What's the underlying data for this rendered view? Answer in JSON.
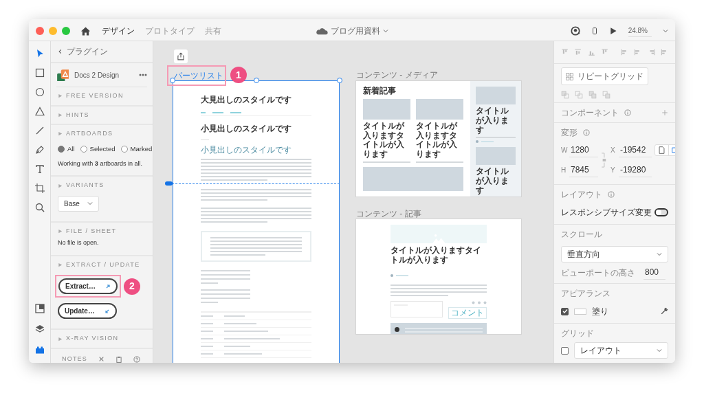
{
  "title_bar": {
    "tabs": [
      {
        "label": "デザイン",
        "selected": true
      },
      {
        "label": "プロトタイプ",
        "selected": false
      },
      {
        "label": "共有",
        "selected": false
      }
    ],
    "document_title": "ブログ用資料",
    "zoom": "24.8%"
  },
  "tools": [
    {
      "kind": "select",
      "selected": true
    },
    {
      "kind": "rectangle",
      "selected": false
    },
    {
      "kind": "ellipse",
      "selected": false
    },
    {
      "kind": "triangle",
      "selected": false
    },
    {
      "kind": "line",
      "selected": false
    },
    {
      "kind": "pen",
      "selected": false
    },
    {
      "kind": "text",
      "selected": false
    },
    {
      "kind": "artboard",
      "selected": false
    },
    {
      "kind": "zoom",
      "selected": false
    }
  ],
  "bottom_tools": [
    {
      "kind": "assets",
      "selected": false
    },
    {
      "kind": "layers",
      "selected": false
    },
    {
      "kind": "plugins",
      "selected": true
    }
  ],
  "plugin_panel": {
    "back_label": "プラグイン",
    "plugin_name": "Docs 2 Design",
    "sections": [
      {
        "kind": "header",
        "title": "FREE VERSION"
      },
      {
        "kind": "header",
        "title": "HINTS"
      },
      {
        "kind": "radios",
        "title": "ARTBOARDS",
        "options": [
          {
            "label": "All",
            "selected": true
          },
          {
            "label": "Selected",
            "selected": false
          },
          {
            "label": "Marked",
            "selected": false
          }
        ],
        "note": "Working with **3** artboards in all."
      },
      {
        "kind": "select",
        "title": "VARIANTS",
        "value": "Base"
      },
      {
        "kind": "note",
        "title": "FILE / SHEET",
        "note": "No file is open."
      },
      {
        "kind": "buttons",
        "title": "EXTRACT / UPDATE",
        "buttons": [
          {
            "label": "Extract…",
            "callout": "2"
          },
          {
            "label": "Update…"
          }
        ]
      },
      {
        "kind": "header",
        "title": "X-RAY VISION"
      }
    ],
    "notes_label": "NOTES"
  },
  "canvas": {
    "artboards": [
      {
        "kind": "parts",
        "title": "パーツリスト",
        "selected": true,
        "callout": "1",
        "heading": "大見出しのスタイルです",
        "subheading": "小見出しのスタイルです",
        "minor_heading": "小見出しのスタイルです"
      },
      {
        "kind": "media",
        "title": "コンテンツ - メディア",
        "selected": false,
        "section_title": "新着記事",
        "cards": [
          {
            "title": "タイトルが入りますタイトルが入ります"
          },
          {
            "title": "タイトルが入りますタイトルが入ります"
          }
        ],
        "side_items": [
          {
            "title": "タイトルが入ります"
          },
          {
            "title": "タイトルが入ります"
          }
        ]
      },
      {
        "kind": "article",
        "title": "コンテンツ - 記事",
        "selected": false,
        "heading": "タイトルが入りますタイトルが入ります",
        "comment_button": "コメント"
      }
    ]
  },
  "properties": {
    "repeat_grid": "リピートグリッド",
    "component_label": "コンポーネント",
    "transform_label": "変形",
    "fields": [
      {
        "label": "W",
        "value": "1280"
      },
      {
        "label": "X",
        "value": "-19542"
      },
      {
        "label": "H",
        "value": "7845"
      },
      {
        "label": "Y",
        "value": "-19280"
      }
    ],
    "orientations": [
      {
        "kind": "portrait",
        "selected": false
      },
      {
        "kind": "landscape",
        "selected": true
      }
    ],
    "layout_label": "レイアウト",
    "responsive": {
      "label": "レスポンシブサイズ変更",
      "on": false
    },
    "scroll_label": "スクロール",
    "scroll_value": "垂直方向",
    "viewport": {
      "label": "ビューポートの高さ",
      "value": "800"
    },
    "appearance_label": "アピアランス",
    "fill": {
      "label": "塗り",
      "checked": true
    },
    "grid_label": "グリッド",
    "grid": {
      "value": "レイアウト",
      "checked": false
    }
  }
}
